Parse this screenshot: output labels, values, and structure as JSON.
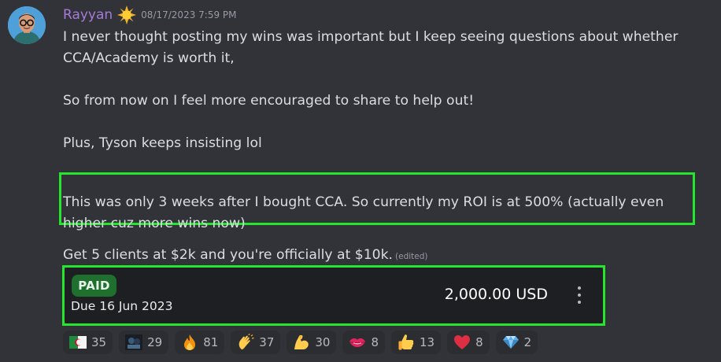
{
  "message": {
    "username": "Rayyan",
    "role_icon": "sun-icon",
    "timestamp": "08/17/2023 7:59 PM",
    "paragraphs": [
      "I never thought posting my wins was important but I keep seeing questions about whether CCA/Academy is worth it,",
      "So from now on I feel more encouraged to share to help out!",
      "Plus, Tyson keeps insisting lol"
    ],
    "highlight_text": "This was only 3 weeks after I bought CCA. So currently my ROI is at 500% (actually even higher cuz more wins now)",
    "last_line": "Get 5 clients at $2k and you're officially at $10k.",
    "edited_label": "(edited)"
  },
  "invoice": {
    "status": "PAID",
    "due": "Due 16 Jun 2023",
    "amount": "2,000.00 USD"
  },
  "reactions": [
    {
      "emoji": "algeria-flag-icon",
      "count": "35"
    },
    {
      "emoji": "custom-gif-icon",
      "count": "29"
    },
    {
      "emoji": "fire-icon",
      "count": "81"
    },
    {
      "emoji": "clapping-hands-icon",
      "count": "37"
    },
    {
      "emoji": "flexed-biceps-icon",
      "count": "30"
    },
    {
      "emoji": "lips-icon",
      "count": "8"
    },
    {
      "emoji": "thumbs-up-icon",
      "count": "13"
    },
    {
      "emoji": "red-heart-icon",
      "count": "8"
    },
    {
      "emoji": "gem-icon",
      "count": "2"
    }
  ],
  "colors": {
    "background": "#313338",
    "username": "#a67ad8",
    "highlight_outline": "#25e62d",
    "paid_badge": "#1f6f2e",
    "embed_background": "#1e1f22"
  }
}
